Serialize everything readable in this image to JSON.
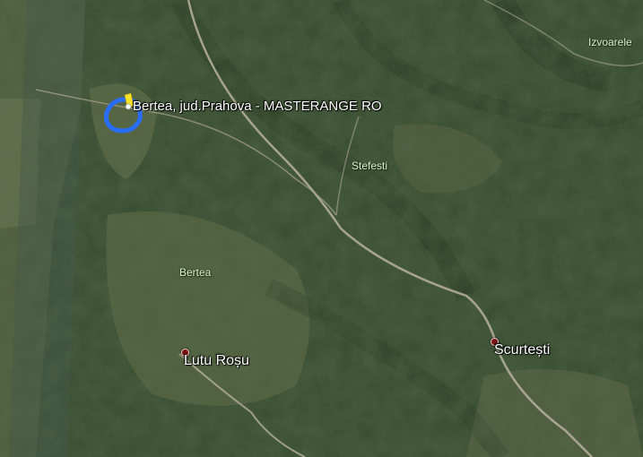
{
  "map": {
    "placemark": {
      "label": "Bertea, jud.Prahova -  MASTERANGE RO",
      "polygon_color": "#2a6df5",
      "icon_color": "#f5e12a"
    },
    "towns": {
      "lutu_rosu": "Lutu Roșu",
      "scurtesti": "Scurtești"
    },
    "regions": {
      "izvoarele": "Izvoarele",
      "stefesti": "Stefesti",
      "bertea": "Bertea"
    },
    "colors": {
      "forest": "#2f4529",
      "pasture": "#5d6a40",
      "road": "#c8c2b0",
      "town_pin": "#7a1212"
    }
  }
}
